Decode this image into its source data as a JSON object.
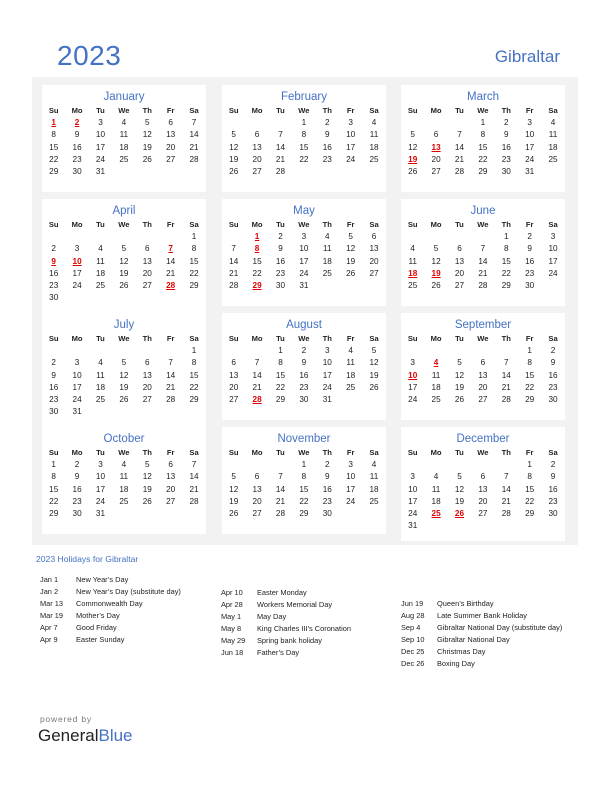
{
  "header": {
    "year": "2023",
    "country": "Gibraltar"
  },
  "weekdays": [
    "Su",
    "Mo",
    "Tu",
    "We",
    "Th",
    "Fr",
    "Sa"
  ],
  "colors": {
    "accent": "#4472c4",
    "holiday": "#e00000",
    "panel_bg": "#f2f2f2"
  },
  "months": [
    {
      "name": "January",
      "start": 0,
      "days": 31,
      "holidays": [
        1,
        2
      ]
    },
    {
      "name": "February",
      "start": 3,
      "days": 28,
      "holidays": []
    },
    {
      "name": "March",
      "start": 3,
      "days": 31,
      "holidays": [
        13,
        19
      ]
    },
    {
      "name": "April",
      "start": 6,
      "days": 30,
      "holidays": [
        7,
        9,
        10,
        28
      ]
    },
    {
      "name": "May",
      "start": 1,
      "days": 31,
      "holidays": [
        1,
        8,
        29
      ]
    },
    {
      "name": "June",
      "start": 4,
      "days": 30,
      "holidays": [
        18,
        19
      ]
    },
    {
      "name": "July",
      "start": 6,
      "days": 31,
      "holidays": []
    },
    {
      "name": "August",
      "start": 2,
      "days": 31,
      "holidays": [
        28
      ]
    },
    {
      "name": "September",
      "start": 5,
      "days": 30,
      "holidays": [
        4,
        10
      ]
    },
    {
      "name": "October",
      "start": 0,
      "days": 31,
      "holidays": []
    },
    {
      "name": "November",
      "start": 3,
      "days": 30,
      "holidays": []
    },
    {
      "name": "December",
      "start": 5,
      "days": 31,
      "holidays": [
        25,
        26
      ]
    }
  ],
  "holidays_title": "2023 Holidays for Gibraltar",
  "holiday_columns": [
    [
      {
        "date": "Jan 1",
        "name": "New Year’s Day"
      },
      {
        "date": "Jan 2",
        "name": "New Year’s Day (substitute day)"
      },
      {
        "date": "Mar 13",
        "name": "Commonwealth Day"
      },
      {
        "date": "Mar 19",
        "name": "Mother’s Day"
      },
      {
        "date": "Apr 7",
        "name": "Good Friday"
      },
      {
        "date": "Apr 9",
        "name": "Easter Sunday"
      }
    ],
    [
      {
        "date": "Apr 10",
        "name": "Easter Monday"
      },
      {
        "date": "Apr 28",
        "name": "Workers Memorial Day"
      },
      {
        "date": "May 1",
        "name": "May Day"
      },
      {
        "date": "May 8",
        "name": "King Charles III’s Coronation"
      },
      {
        "date": "May 29",
        "name": "Spring bank holiday"
      },
      {
        "date": "Jun 18",
        "name": "Father’s Day"
      }
    ],
    [
      {
        "date": "Jun 19",
        "name": "Queen’s Birthday"
      },
      {
        "date": "Aug 28",
        "name": "Late Summer Bank Holiday"
      },
      {
        "date": "Sep 4",
        "name": "Gibraltar National Day (substitute day)"
      },
      {
        "date": "Sep 10",
        "name": "Gibraltar National Day"
      },
      {
        "date": "Dec 25",
        "name": "Christmas Day"
      },
      {
        "date": "Dec 26",
        "name": "Boxing Day"
      }
    ]
  ],
  "footer": {
    "powered_by": "powered by",
    "brand_general": "General",
    "brand_blue": "Blue"
  }
}
